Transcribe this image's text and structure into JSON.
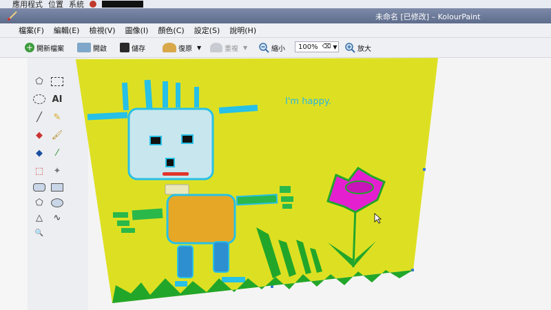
{
  "desktop": {
    "items": [
      "應用程式",
      "位置",
      "系統"
    ]
  },
  "window": {
    "title": "未命名 [已修改] – KolourPaint"
  },
  "menu": {
    "items": [
      "檔案(F)",
      "編輯(E)",
      "檢視(V)",
      "圖像(I)",
      "顏色(C)",
      "設定(S)",
      "說明(H)"
    ]
  },
  "toolbar": {
    "new_label": "開新檔案",
    "open_label": "開啟",
    "save_label": "儲存",
    "undo_label": "復原",
    "redo_label": "重複",
    "zoom_out_label": "縮小",
    "zoom_value": "100%",
    "zoom_in_label": "放大"
  },
  "tools": {
    "text_tool_label": "AI"
  },
  "canvas": {
    "background_color": "#dde022",
    "caption": "I'm happy."
  },
  "colors": {
    "cyan": "#27c0e6",
    "orange": "#e7a726",
    "green": "#22a62a",
    "magenta": "#e41fd0",
    "red": "#e2342a"
  }
}
